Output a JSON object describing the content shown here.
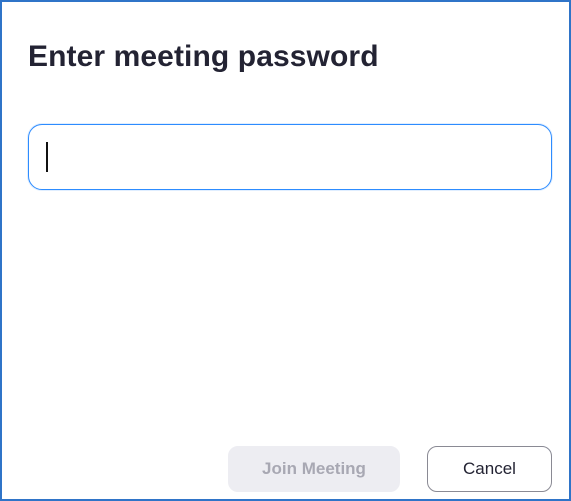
{
  "dialog": {
    "title": "Enter meeting password",
    "password_input": {
      "value": "",
      "placeholder": ""
    },
    "join_button_label": "Join Meeting",
    "cancel_button_label": "Cancel"
  },
  "colors": {
    "accent_blue": "#2d8cff",
    "title_text": "#232333",
    "disabled_bg": "#ededf2",
    "disabled_text": "#a8a8b3"
  }
}
